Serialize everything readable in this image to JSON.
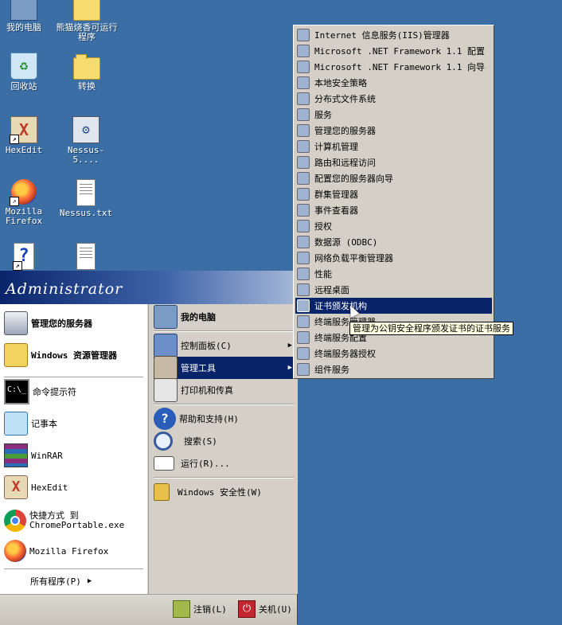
{
  "desktop": {
    "icons": [
      {
        "label": "我的电脑",
        "icon": "my-computer-icon"
      },
      {
        "label": "熊猫烧香可运行程序",
        "icon": "folder-icon"
      },
      {
        "label": "回收站",
        "icon": "recycle-bin-icon"
      },
      {
        "label": "转换",
        "icon": "folder-icon"
      },
      {
        "label": "HexEdit",
        "icon": "hexedit-icon"
      },
      {
        "label": "Nessus-5....",
        "icon": "nessus-installer-icon"
      },
      {
        "label": "Mozilla Firefox",
        "icon": "firefox-icon"
      },
      {
        "label": "Nessus.txt",
        "icon": "text-file-icon"
      },
      {
        "label": "",
        "icon": "help-file-icon"
      },
      {
        "label": "",
        "icon": "text-file-icon"
      }
    ]
  },
  "start_menu": {
    "user": "Administrator",
    "left_pinned": [
      {
        "label": "管理您的服务器",
        "icon": "server-manage-icon"
      },
      {
        "label": "Windows 资源管理器",
        "icon": "explorer-icon"
      }
    ],
    "left_recent": [
      {
        "label": "命令提示符",
        "icon": "cmd-icon"
      },
      {
        "label": "记事本",
        "icon": "notepad-icon"
      },
      {
        "label": "WinRAR",
        "icon": "winrar-icon"
      },
      {
        "label": "HexEdit",
        "icon": "hexedit-icon"
      },
      {
        "label_line1": "快捷方式 到",
        "label_line2": "ChromePortable.exe",
        "icon": "chrome-icon"
      },
      {
        "label": "Mozilla Firefox",
        "icon": "firefox-icon"
      }
    ],
    "all_programs": "所有程序(P)",
    "right": {
      "my_computer": "我的电脑",
      "control_panel": "控制面板(C)",
      "admin_tools": "管理工具",
      "printers": "打印机和传真",
      "help": "帮助和支持(H)",
      "search": "搜索(S)",
      "run": "运行(R)...",
      "security": "Windows 安全性(W)"
    },
    "logoff": "注销(L)",
    "shutdown": "关机(U)"
  },
  "admin_tools_menu": {
    "items": [
      "Internet 信息服务(IIS)管理器",
      "Microsoft .NET Framework 1.1 配置",
      "Microsoft .NET Framework 1.1 向导",
      "本地安全策略",
      "分布式文件系统",
      "服务",
      "管理您的服务器",
      "计算机管理",
      "路由和远程访问",
      "配置您的服务器向导",
      "群集管理器",
      "事件查看器",
      "授权",
      "数据源 (ODBC)",
      "网络负载平衡管理器",
      "性能",
      "远程桌面",
      "证书颁发机构",
      "终端服务管理器",
      "终端服务配置",
      "终端服务器授权",
      "组件服务"
    ],
    "highlighted_index": 17
  },
  "tooltip": "管理为公钥安全程序颁发证书的证书服务",
  "colors": {
    "desktop": "#3a6ea5",
    "highlight": "#0a246a",
    "menu": "#d4d0c8"
  }
}
